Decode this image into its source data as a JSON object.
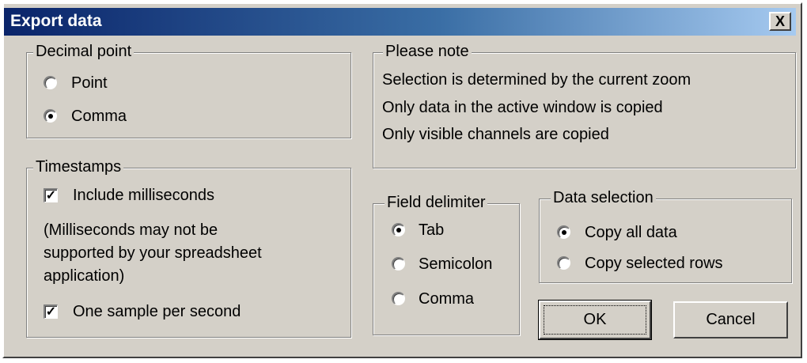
{
  "window": {
    "title": "Export data",
    "close_label": "X"
  },
  "decimal_point": {
    "legend": "Decimal point",
    "options": [
      {
        "label": "Point",
        "selected": false
      },
      {
        "label": "Comma",
        "selected": true
      }
    ]
  },
  "timestamps": {
    "legend": "Timestamps",
    "include_ms": {
      "label": "Include milliseconds",
      "checked": true
    },
    "note_lines": [
      "(Milliseconds may not be",
      "supported by your spreadsheet",
      "application)"
    ],
    "one_sample": {
      "label": "One sample per second",
      "checked": true
    }
  },
  "please_note": {
    "legend": "Please note",
    "lines": [
      "Selection is determined by the current zoom",
      "Only data in the active window is copied",
      "Only visible channels are copied"
    ]
  },
  "field_delimiter": {
    "legend": "Field delimiter",
    "options": [
      {
        "label": "Tab",
        "selected": true
      },
      {
        "label": "Semicolon",
        "selected": false
      },
      {
        "label": "Comma",
        "selected": false
      }
    ]
  },
  "data_selection": {
    "legend": "Data selection",
    "options": [
      {
        "label": "Copy all data",
        "selected": true
      },
      {
        "label": "Copy selected rows",
        "selected": false
      }
    ]
  },
  "buttons": {
    "ok": "OK",
    "cancel": "Cancel"
  },
  "colors": {
    "dialog_bg": "#d4d0c8",
    "title_start": "#0a246a",
    "title_end": "#a6caf0"
  }
}
